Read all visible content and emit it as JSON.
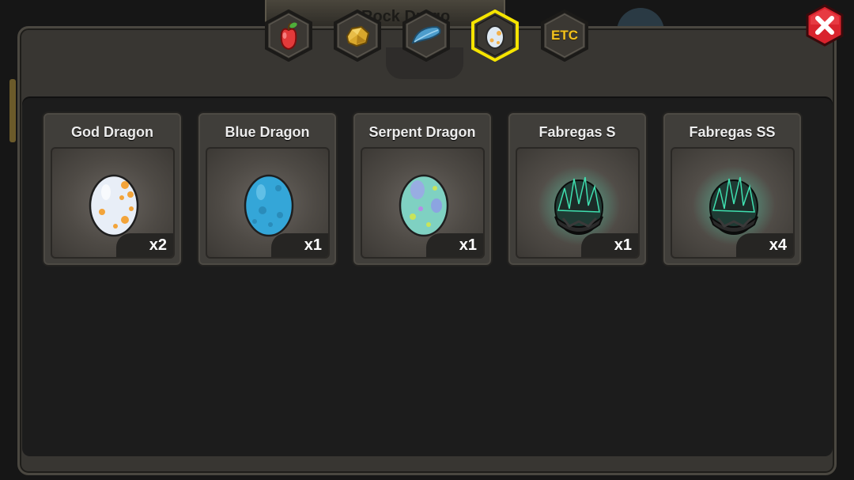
{
  "background": {
    "banner_text": "Rock Drago"
  },
  "tabs": [
    {
      "name": "fruit",
      "icon": "apple-icon",
      "label": ""
    },
    {
      "name": "gold",
      "icon": "gold-ore-icon",
      "label": ""
    },
    {
      "name": "feather",
      "icon": "blue-feather-icon",
      "label": ""
    },
    {
      "name": "egg",
      "icon": "egg-icon",
      "label": "",
      "selected": true
    },
    {
      "name": "etc",
      "icon": "etc-icon",
      "label": "ETC"
    }
  ],
  "close_button": {
    "icon": "close-x-icon"
  },
  "items": [
    {
      "name": "God Dragon",
      "quantity": "x2",
      "icon": "white-orange-spotted-egg-icon"
    },
    {
      "name": "Blue Dragon",
      "quantity": "x1",
      "icon": "blue-egg-icon"
    },
    {
      "name": "Serpent Dragon",
      "quantity": "x1",
      "icon": "teal-spotted-egg-icon"
    },
    {
      "name": "Fabregas S",
      "quantity": "x1",
      "icon": "dark-spiked-egg-icon"
    },
    {
      "name": "Fabregas SS",
      "quantity": "x4",
      "icon": "dark-spiked-egg-icon"
    }
  ],
  "colors": {
    "selected_tab_border": "#f5e400",
    "tab_fill": "#3b3833",
    "close_red": "#d9232d",
    "panel": "#383632"
  }
}
